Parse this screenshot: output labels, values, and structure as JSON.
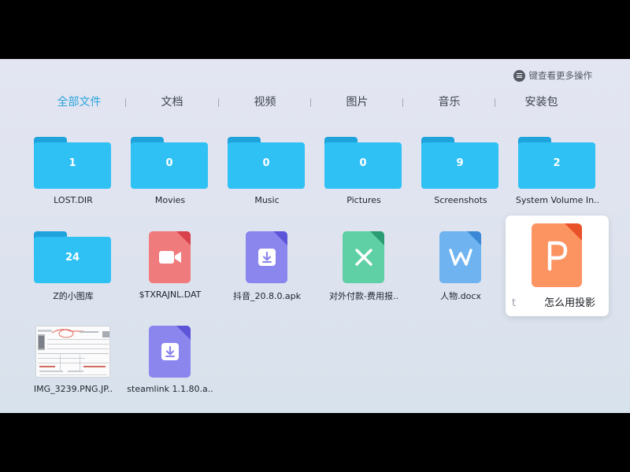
{
  "menu_hint": {
    "icon": "menu-icon",
    "text": "键查看更多操作"
  },
  "tabs": [
    "全部文件",
    "文档",
    "视频",
    "图片",
    "音乐",
    "安装包"
  ],
  "active_tab": "全部文件",
  "colors": {
    "accent": "#2aa4dd",
    "folder": "#2fc1f4",
    "folder_tab": "#1fa3dd",
    "video": "#f07b7c",
    "apk": "#8b85ee",
    "excel": "#5fcfa5",
    "word": "#6fb4f0",
    "ppt": "#fc9462"
  },
  "files": [
    {
      "type": "folder",
      "name": "LOST.DIR",
      "count": "1"
    },
    {
      "type": "folder",
      "name": "Movies",
      "count": "0"
    },
    {
      "type": "folder",
      "name": "Music",
      "count": "0"
    },
    {
      "type": "folder",
      "name": "Pictures",
      "count": "0"
    },
    {
      "type": "folder",
      "name": "Screenshots",
      "count": "9"
    },
    {
      "type": "folder",
      "name": "System Volume In..",
      "count": "2"
    },
    {
      "type": "folder",
      "name": "Z的小图库",
      "count": "24"
    },
    {
      "type": "video",
      "name": "$TXRAJNL.DAT",
      "icon": "video-camera-icon"
    },
    {
      "type": "apk",
      "name": "抖音_20.8.0.apk",
      "icon": "download-icon"
    },
    {
      "type": "excel",
      "name": "对外付款-费用报..",
      "icon": "x-icon"
    },
    {
      "type": "word",
      "name": "人物.docx",
      "icon": "w-icon"
    },
    {
      "type": "ppt",
      "name": "怎么用投影",
      "name_prefix": "t",
      "icon": "p-icon",
      "focused": true
    },
    {
      "type": "image",
      "name": "IMG_3239.PNG.JP.."
    },
    {
      "type": "apk",
      "name": "steamlink 1.1.80.a..",
      "icon": "download-icon"
    }
  ]
}
